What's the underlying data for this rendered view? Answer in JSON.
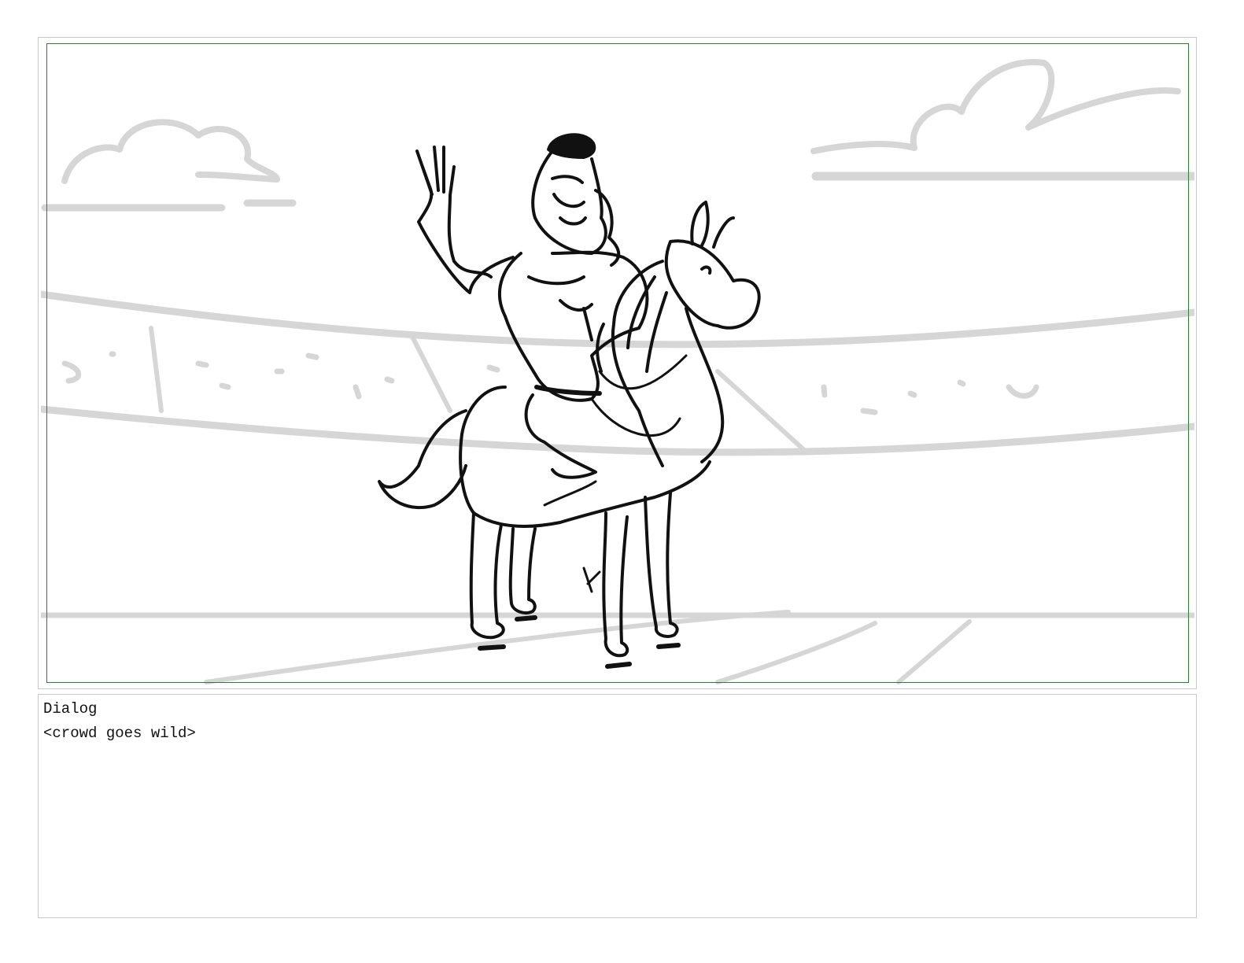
{
  "panel": {
    "description_icon": "storyboard-sketch",
    "frame_color": "#c8c8c8",
    "safe_area_color": "#2e7d32",
    "background_stroke_color": "#d6d6d6",
    "ink_color": "#111111"
  },
  "dialog": {
    "label": "Dialog",
    "text": "<crowd goes wild>"
  }
}
